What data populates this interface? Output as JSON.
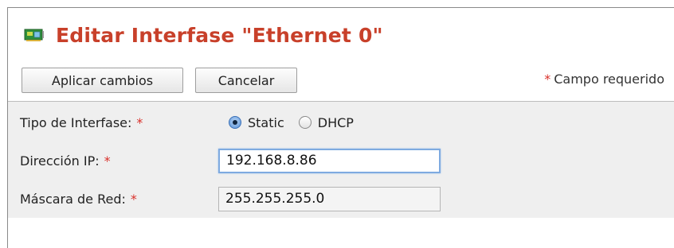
{
  "header": {
    "title": "Editar Interfase \"Ethernet 0\"",
    "icon": "network-card-icon"
  },
  "toolbar": {
    "apply_label": "Aplicar cambios",
    "cancel_label": "Cancelar",
    "required_star": "*",
    "required_note": "Campo requerido"
  },
  "form": {
    "interface_type": {
      "label": "Tipo de Interfase:",
      "required_star": "*",
      "options": [
        {
          "label": "Static",
          "checked": true
        },
        {
          "label": "DHCP",
          "checked": false
        }
      ]
    },
    "ip_address": {
      "label": "Dirección IP:",
      "required_star": "*",
      "value": "192.168.8.86"
    },
    "netmask": {
      "label": "Máscara de Red:",
      "required_star": "*",
      "value": "255.255.255.0"
    }
  },
  "colors": {
    "title": "#c8402a",
    "required": "#d9302a",
    "form_background": "#efefef",
    "focus_border": "#7eaae0"
  }
}
